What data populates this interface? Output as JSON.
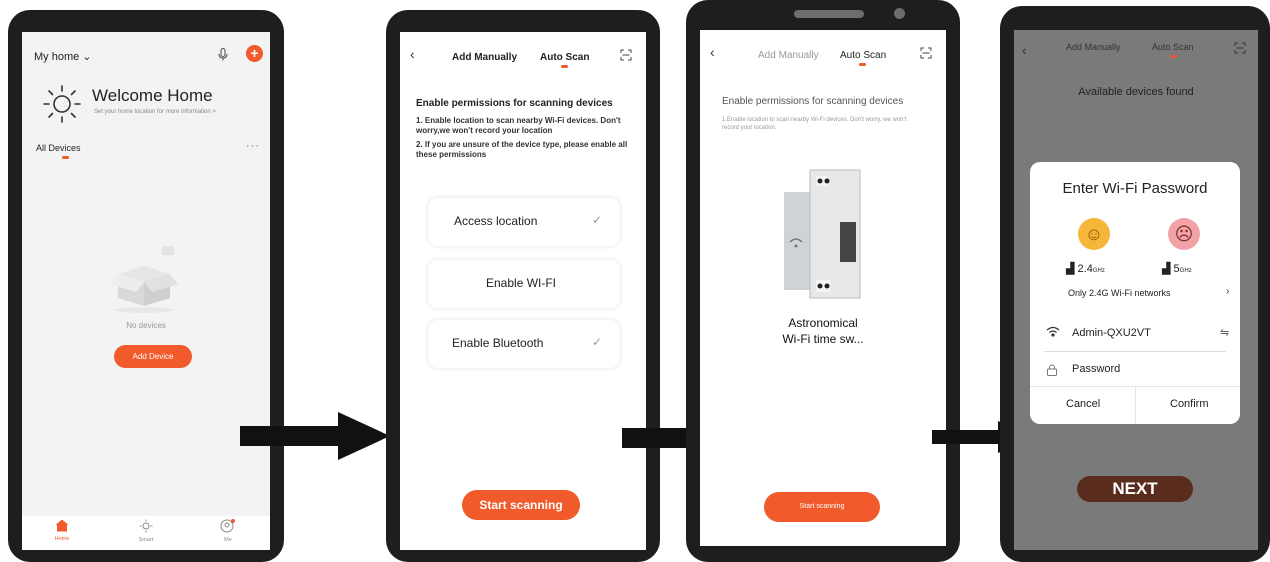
{
  "phone1": {
    "home_selector": "My home ⌄",
    "welcome_title": "Welcome Home",
    "welcome_subtitle": "Set your home location for more information  >",
    "all_devices_tab": "All Devices",
    "more": "···",
    "no_devices": "No devices",
    "add_device_button": "Add Device",
    "tabs": [
      {
        "label": "Home",
        "icon": "home-icon"
      },
      {
        "label": "Smart",
        "icon": "smart-icon"
      },
      {
        "label": "Me",
        "icon": "me-icon"
      }
    ]
  },
  "phone2": {
    "tab_manual": "Add Manually",
    "tab_auto": "Auto Scan",
    "perm_title": "Enable permissions for scanning devices",
    "perm_line1": "1. Enable location to scan nearby Wi-Fi devices. Don't worry,we won't record your location",
    "perm_line2": "2. If you are unsure of the device type, please enable all these permissions",
    "access_location": "Access location",
    "enable_wifi": "Enable WI-FI",
    "enable_bluetooth": "Enable Bluetooth",
    "start_button": "Start scanning"
  },
  "phone3": {
    "tab_manual": "Add Manually",
    "tab_auto": "Auto Scan",
    "perm_title": "Enable permissions for scanning devices",
    "perm_text": "1.Enable location to scan nearby Wi-Fi devices. Don't worry, we won't record your location.",
    "device_name_line1": "Astronomical",
    "device_name_line2": "Wi-Fi time sw...",
    "start_button": "Start scanning"
  },
  "phone4": {
    "tab_manual": "Add Manually",
    "tab_auto": "Auto Scan",
    "available": "Available devices found",
    "dialog_title": "Enter Wi-Fi Password",
    "band_24": "2.4",
    "band_24_unit": "GHz",
    "band_5": "5",
    "band_5_unit": "GHz",
    "only_24": "Only 2.4G Wi-Fi networks",
    "wifi_name": "Admin-QXU2VT",
    "password_placeholder": "Password",
    "cancel": "Cancel",
    "confirm": "Confirm",
    "next_button": "NEXT"
  },
  "colors": {
    "accent": "#f15a2a",
    "phone_frame": "#1e1e1e",
    "next_button": "#5a2c1e"
  }
}
